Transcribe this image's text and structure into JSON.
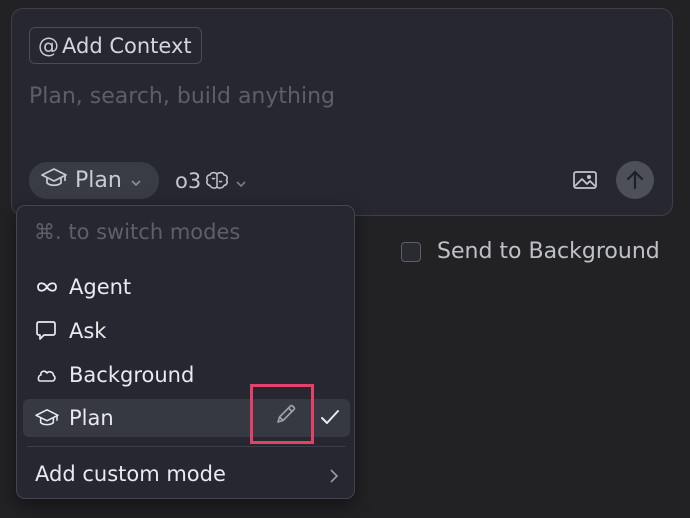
{
  "composer": {
    "add_context_symbol": "@",
    "add_context_label": "Add Context",
    "placeholder": "Plan, search, build anything",
    "mode_label": "Plan",
    "model_label": "o3"
  },
  "background_toggle": {
    "label": "Send to Background",
    "checked": false
  },
  "mode_menu": {
    "hint": "⌘. to switch modes",
    "items": [
      {
        "label": "Agent",
        "icon": "infinity-icon"
      },
      {
        "label": "Ask",
        "icon": "chat-bubble-icon"
      },
      {
        "label": "Background",
        "icon": "cloud-icon"
      },
      {
        "label": "Plan",
        "icon": "graduation-cap-icon",
        "selected": true
      }
    ],
    "add_custom_label": "Add custom mode"
  },
  "colors": {
    "background": "#222225",
    "panel": "#262730",
    "highlight": "#e2426a"
  }
}
